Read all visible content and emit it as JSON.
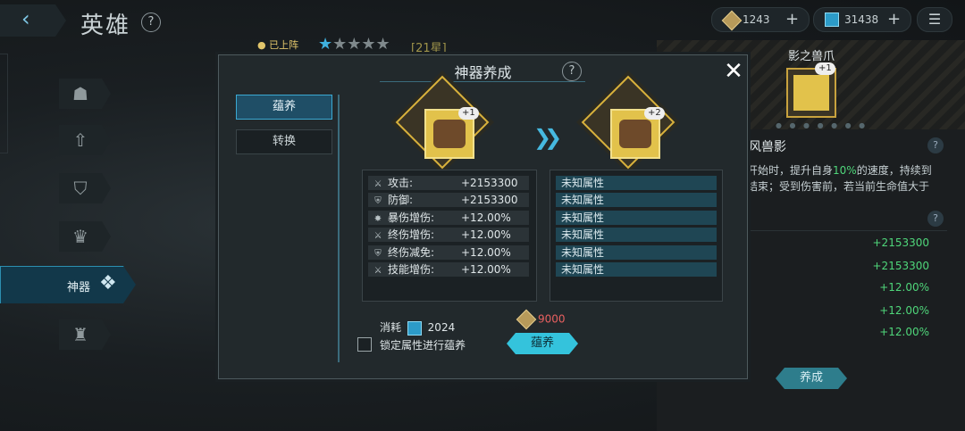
{
  "header": {
    "title": "英雄",
    "help": "?",
    "gold_amount": "1243",
    "gem_amount": "31438"
  },
  "hero": {
    "deploy_status": "已上阵",
    "star_label": "[21星]"
  },
  "sidebar": {
    "active_label": "神器"
  },
  "dialog": {
    "title": "神器养成",
    "help": "?",
    "close": "✕",
    "tabs": [
      {
        "label": "蕴养"
      },
      {
        "label": "转换"
      }
    ],
    "current": {
      "level": "+1"
    },
    "next": {
      "level": "+2"
    },
    "stats": [
      {
        "icon": "attack-icon",
        "label": "攻击:",
        "value": "+2153300",
        "next": "未知属性"
      },
      {
        "icon": "defense-icon",
        "label": "防御:",
        "value": "+2153300",
        "next": "未知属性"
      },
      {
        "icon": "crit-damage-icon",
        "label": "暴伤增伤:",
        "value": "+12.00%",
        "next": "未知属性"
      },
      {
        "icon": "final-damage-icon",
        "label": "终伤增伤:",
        "value": "+12.00%",
        "next": "未知属性"
      },
      {
        "icon": "final-reduction-icon",
        "label": "终伤减免:",
        "value": "+12.00%",
        "next": "未知属性"
      },
      {
        "icon": "skill-damage-icon",
        "label": "技能增伤:",
        "value": "+12.00%",
        "next": "未知属性"
      }
    ],
    "cost_label": "消耗",
    "cost_amount": "2024",
    "lock_label": "锁定属性进行蕴养",
    "gold_cost": "9000",
    "cultivate_button": "蕴养"
  },
  "right_panel": {
    "artifact_name": "影之兽爪",
    "artifact_level": "+1",
    "skill_name": "风兽影",
    "skill_desc_line1_pre": "斗开始时，提升自身",
    "skill_desc_pct": "10%",
    "skill_desc_line1_post": "的速度，持续到",
    "skill_desc_line2": "斗结束；受到伤害前，若当前生命值大于",
    "values": [
      "+2153300",
      "+2153300",
      "+12.00%",
      "+12.00%",
      "+12.00%"
    ],
    "upgrade_button": "养成"
  },
  "colors": {
    "accent": "#34c3dc",
    "gold": "#e4b55a",
    "green": "#4fd67a",
    "cost_red": "#e86060"
  }
}
